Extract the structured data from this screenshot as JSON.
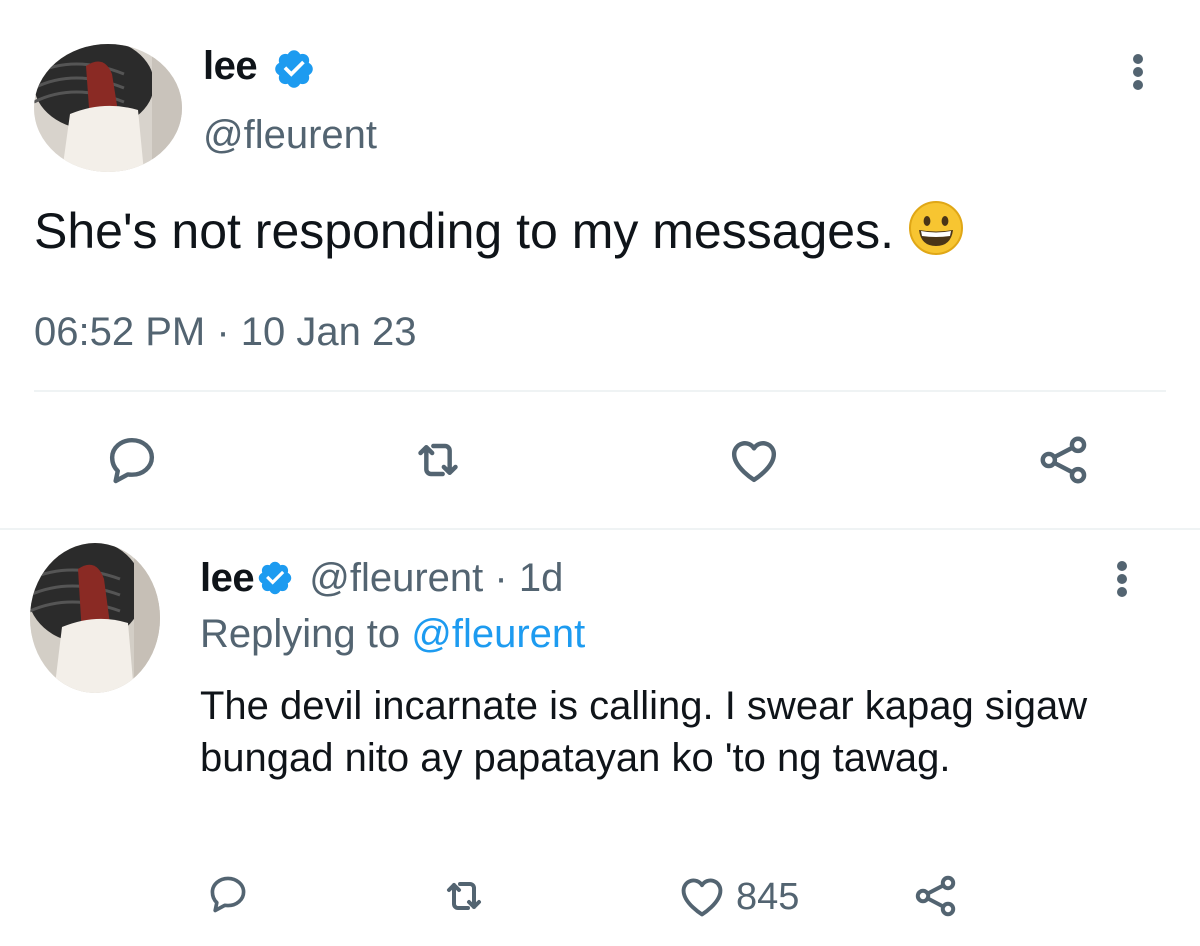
{
  "main_tweet": {
    "name": "lee",
    "handle": "@fleurent",
    "text": "She's not responding to my messages.",
    "emoji_icon": "grinning-face-emoji",
    "timestamp": "06:52 PM · 10 Jan 23",
    "actions": [
      "reply-icon",
      "retweet-icon",
      "like-icon",
      "share-icon"
    ]
  },
  "reply_tweet": {
    "name": "lee",
    "handle": "@fleurent",
    "separator": "·",
    "age": "1d",
    "replying_prefix": "Replying to",
    "replying_to": "@fleurent",
    "text": "The devil incarnate is calling. I swear kapag sigaw bungad nito ay papatayan ko 'to ng tawag.",
    "like_count": "845"
  },
  "colors": {
    "verified": "#1d9bf0",
    "secondary_text": "#536471",
    "primary_text": "#0f1419",
    "divider": "#eff3f4"
  }
}
